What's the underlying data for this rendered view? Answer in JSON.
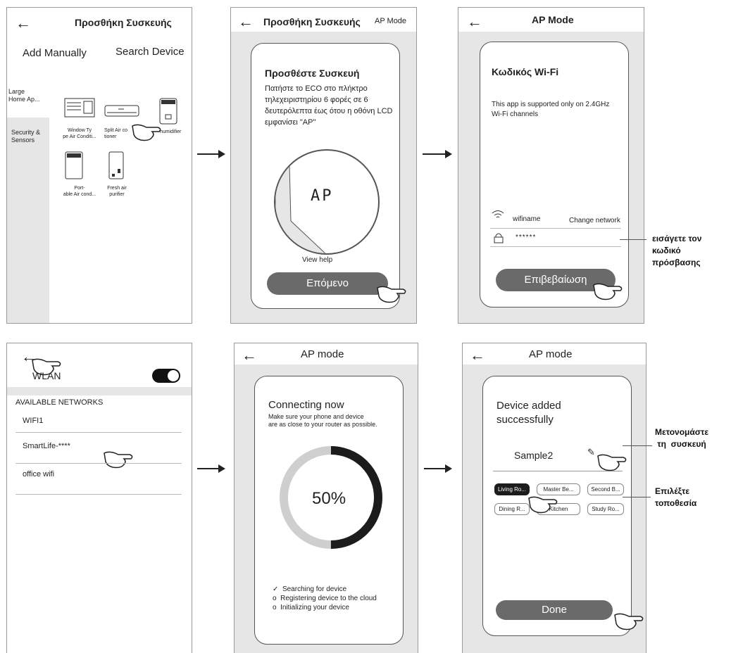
{
  "panel1": {
    "title": "Προσθήκη Συσκευής",
    "tab_manual": "Add Manually",
    "tab_search": "Search Device",
    "categories": [
      "Large\nHome Ap...",
      "Security &\nSensors"
    ],
    "devices": [
      {
        "label": "Window Ty\npe Air Conditi...",
        "icon": "window-ac-icon"
      },
      {
        "label": "Split Air co\ntioner",
        "icon": "split-ac-icon"
      },
      {
        "label": "humidifier",
        "icon": "dehumidifier-icon"
      },
      {
        "label": "Port-\nable Air cond...",
        "icon": "portable-ac-icon"
      },
      {
        "label": "Fresh air\npurifier",
        "icon": "air-purifier-icon"
      }
    ]
  },
  "panel2": {
    "title": "Προσθήκη Συσκευής",
    "mode_link": "AP Mode",
    "heading": "Προσθέστε Συσκευή",
    "instructions": "Πατήστε το ECO στο πλήκτρο τηλεχειριστηρίου 6 φορές σε 6 δευτερόλεπτα έως ότου η οθόνη LCD εμφανίσει \"AP\"",
    "lcd_text": "AP",
    "help_link": "View help",
    "next_button": "Επόμενο"
  },
  "panel3": {
    "title": "AP Mode",
    "heading": "Κωδικός Wi-Fi",
    "notice": "This app is supported only on 2.4GHz Wi-Fi channels",
    "wifi_name": "wifiname",
    "change_network": "Change network",
    "password_mask": "******",
    "confirm_button": "Επιβεβαίωση",
    "annotation": "εισάγετε τον\nκωδικό\nπρόσβασης"
  },
  "panel4": {
    "wlan_label": "WLAN",
    "section_header": "AVAILABLE NETWORKS",
    "networks": [
      "WIFI1",
      "SmartLife-****",
      "office wifi"
    ]
  },
  "panel5": {
    "title": "AP mode",
    "heading": "Connecting now",
    "subtext": "Make sure your phone and device\nare as close to your router as possible.",
    "progress_percent": 50,
    "progress_text": "50%",
    "steps": [
      {
        "marker": "✓",
        "text": "Searching for device"
      },
      {
        "marker": "o",
        "text": "Registering device to the cloud"
      },
      {
        "marker": "o",
        "text": "Initializing your device"
      }
    ]
  },
  "panel6": {
    "title": "AP mode",
    "heading": "Device added\nsuccessfully",
    "device_name": "Sample2",
    "rooms": [
      "Living Ro...",
      "Master Be...",
      "Second B...",
      "Dining R...",
      "Kitchen",
      "Study Ro..."
    ],
    "selected_room": "Living Ro...",
    "done_button": "Done",
    "annotation_rename": "Μετονομάστε\nτη  συσκευή",
    "annotation_location": "Επιλέξτε\nτοποθεσία"
  },
  "colors": {
    "button_grey": "#6a6a6a",
    "panel_grey": "#e6e6e6",
    "progress_dark": "#1c1c1c",
    "progress_light": "#cfcfcf"
  }
}
